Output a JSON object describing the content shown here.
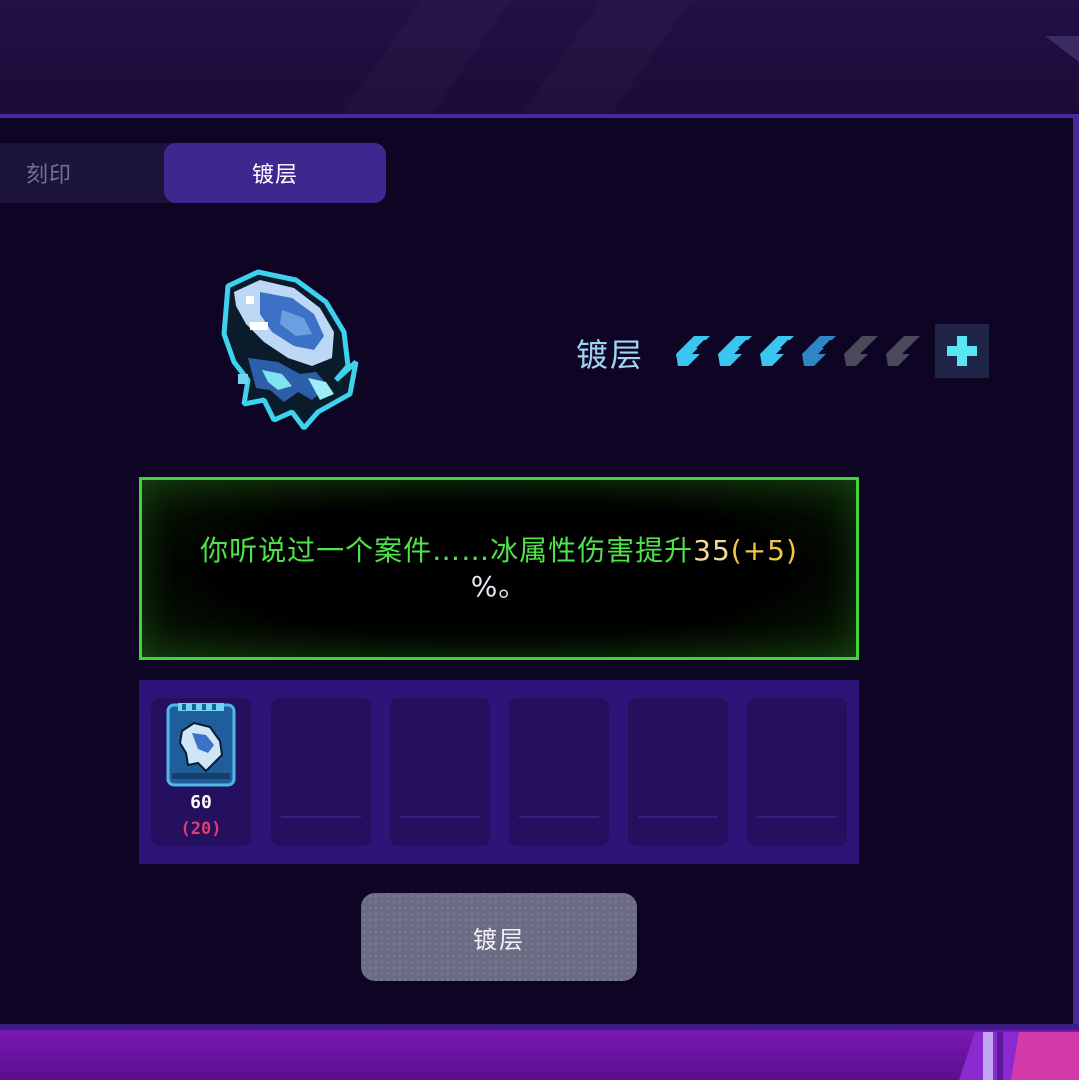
{
  "tabs": [
    {
      "label": "刻印",
      "active": false
    },
    {
      "label": "镀层",
      "active": true
    }
  ],
  "item": {
    "icon": "ice-fish-weapon-icon"
  },
  "coating": {
    "label": "镀层",
    "level": 4,
    "max": 6,
    "add_icon": "plus-icon"
  },
  "description": {
    "main": "你听说过一个案件……冰属性伤害提升",
    "value": "35",
    "bonus": "(+5)",
    "suffix": "%。"
  },
  "slots": [
    {
      "filled": true,
      "icon": "ice-fish-card-icon",
      "count": "60",
      "cost": "(20)"
    },
    {
      "filled": false
    },
    {
      "filled": false
    },
    {
      "filled": false
    },
    {
      "filled": false
    },
    {
      "filled": false
    }
  ],
  "action_button": {
    "label": "镀层"
  },
  "colors": {
    "accent_green": "#3ed43a",
    "active_tab": "#3f2790",
    "pip_active": "#3bc6f0",
    "pip_inactive": "#4a4a5c",
    "cost_red": "#e23c6e"
  }
}
